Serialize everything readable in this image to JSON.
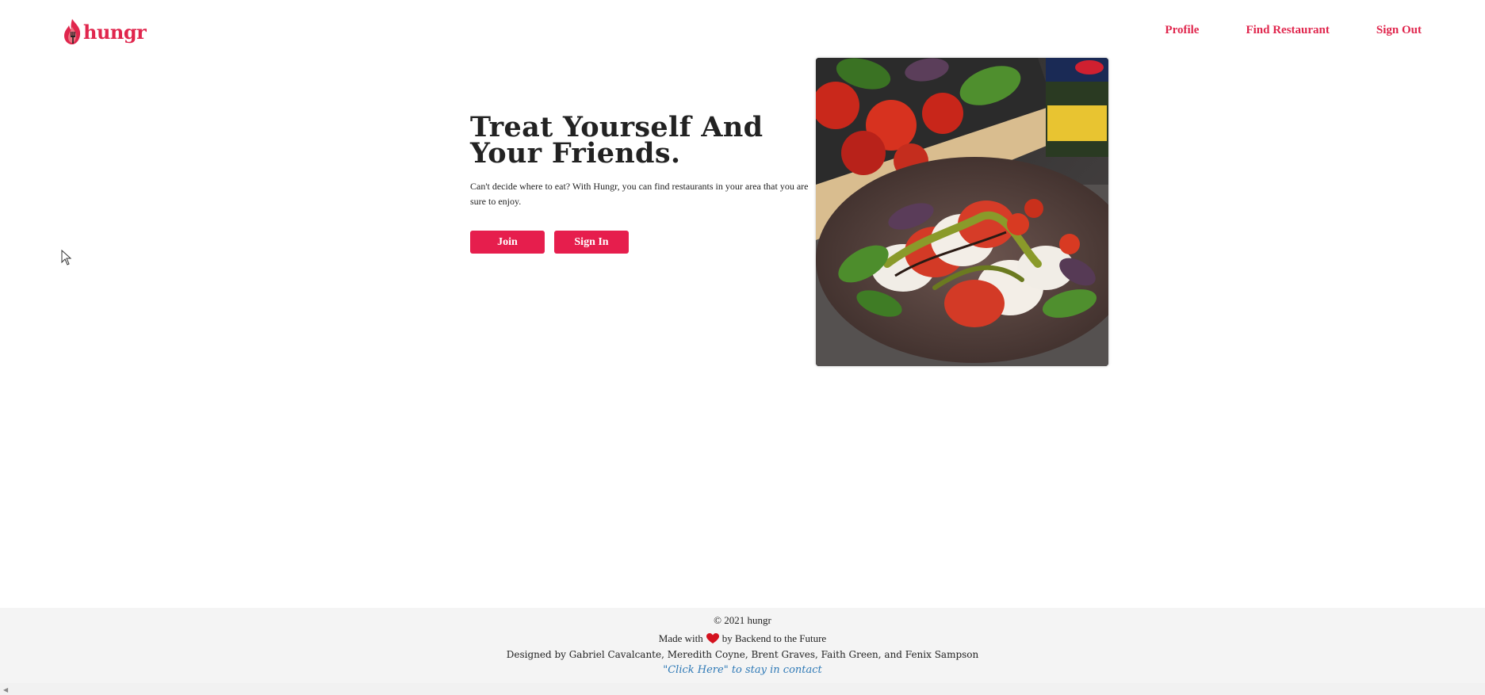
{
  "brand": {
    "name": "hungr",
    "color": "#e0264d"
  },
  "nav": {
    "profile": "Profile",
    "find_restaurant": "Find Restaurant",
    "sign_out": "Sign Out"
  },
  "hero": {
    "title": "Treat Yourself And Your Friends.",
    "description": "Can't decide where to eat? With Hungr, you can find restaurants in your area that you are sure to enjoy.",
    "join_label": "Join",
    "signin_label": "Sign In",
    "image_icon": "caprese-salad-photo"
  },
  "footer": {
    "copyright": "© 2021 hungr",
    "made_with_prefix": "Made with",
    "made_with_suffix": "by Backend to the Future",
    "designed_by": "Designed by Gabriel Cavalcante, Meredith Coyne, Brent Graves, Faith Green, and Fenix Sampson",
    "contact_link": "\"Click Here\" to stay in contact",
    "link_color": "#2e79b6"
  },
  "colors": {
    "accent": "#e61e4d",
    "footer_bg": "#f4f4f4"
  }
}
